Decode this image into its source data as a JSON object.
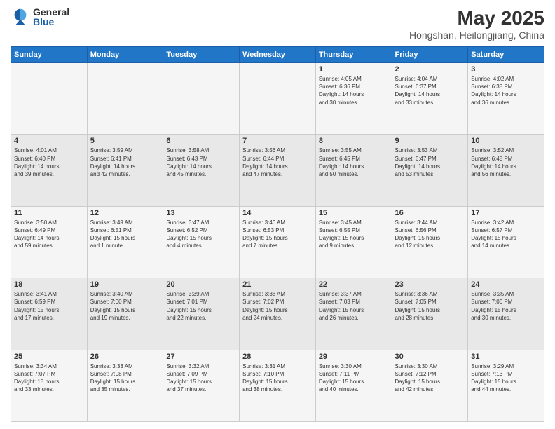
{
  "logo": {
    "general": "General",
    "blue": "Blue"
  },
  "header": {
    "title": "May 2025",
    "subtitle": "Hongshan, Heilongjiang, China"
  },
  "weekdays": [
    "Sunday",
    "Monday",
    "Tuesday",
    "Wednesday",
    "Thursday",
    "Friday",
    "Saturday"
  ],
  "weeks": [
    [
      {
        "day": "",
        "info": ""
      },
      {
        "day": "",
        "info": ""
      },
      {
        "day": "",
        "info": ""
      },
      {
        "day": "",
        "info": ""
      },
      {
        "day": "1",
        "info": "Sunrise: 4:05 AM\nSunset: 6:36 PM\nDaylight: 14 hours\nand 30 minutes."
      },
      {
        "day": "2",
        "info": "Sunrise: 4:04 AM\nSunset: 6:37 PM\nDaylight: 14 hours\nand 33 minutes."
      },
      {
        "day": "3",
        "info": "Sunrise: 4:02 AM\nSunset: 6:38 PM\nDaylight: 14 hours\nand 36 minutes."
      }
    ],
    [
      {
        "day": "4",
        "info": "Sunrise: 4:01 AM\nSunset: 6:40 PM\nDaylight: 14 hours\nand 39 minutes."
      },
      {
        "day": "5",
        "info": "Sunrise: 3:59 AM\nSunset: 6:41 PM\nDaylight: 14 hours\nand 42 minutes."
      },
      {
        "day": "6",
        "info": "Sunrise: 3:58 AM\nSunset: 6:43 PM\nDaylight: 14 hours\nand 45 minutes."
      },
      {
        "day": "7",
        "info": "Sunrise: 3:56 AM\nSunset: 6:44 PM\nDaylight: 14 hours\nand 47 minutes."
      },
      {
        "day": "8",
        "info": "Sunrise: 3:55 AM\nSunset: 6:45 PM\nDaylight: 14 hours\nand 50 minutes."
      },
      {
        "day": "9",
        "info": "Sunrise: 3:53 AM\nSunset: 6:47 PM\nDaylight: 14 hours\nand 53 minutes."
      },
      {
        "day": "10",
        "info": "Sunrise: 3:52 AM\nSunset: 6:48 PM\nDaylight: 14 hours\nand 56 minutes."
      }
    ],
    [
      {
        "day": "11",
        "info": "Sunrise: 3:50 AM\nSunset: 6:49 PM\nDaylight: 14 hours\nand 59 minutes."
      },
      {
        "day": "12",
        "info": "Sunrise: 3:49 AM\nSunset: 6:51 PM\nDaylight: 15 hours\nand 1 minute."
      },
      {
        "day": "13",
        "info": "Sunrise: 3:47 AM\nSunset: 6:52 PM\nDaylight: 15 hours\nand 4 minutes."
      },
      {
        "day": "14",
        "info": "Sunrise: 3:46 AM\nSunset: 6:53 PM\nDaylight: 15 hours\nand 7 minutes."
      },
      {
        "day": "15",
        "info": "Sunrise: 3:45 AM\nSunset: 6:55 PM\nDaylight: 15 hours\nand 9 minutes."
      },
      {
        "day": "16",
        "info": "Sunrise: 3:44 AM\nSunset: 6:56 PM\nDaylight: 15 hours\nand 12 minutes."
      },
      {
        "day": "17",
        "info": "Sunrise: 3:42 AM\nSunset: 6:57 PM\nDaylight: 15 hours\nand 14 minutes."
      }
    ],
    [
      {
        "day": "18",
        "info": "Sunrise: 3:41 AM\nSunset: 6:59 PM\nDaylight: 15 hours\nand 17 minutes."
      },
      {
        "day": "19",
        "info": "Sunrise: 3:40 AM\nSunset: 7:00 PM\nDaylight: 15 hours\nand 19 minutes."
      },
      {
        "day": "20",
        "info": "Sunrise: 3:39 AM\nSunset: 7:01 PM\nDaylight: 15 hours\nand 22 minutes."
      },
      {
        "day": "21",
        "info": "Sunrise: 3:38 AM\nSunset: 7:02 PM\nDaylight: 15 hours\nand 24 minutes."
      },
      {
        "day": "22",
        "info": "Sunrise: 3:37 AM\nSunset: 7:03 PM\nDaylight: 15 hours\nand 26 minutes."
      },
      {
        "day": "23",
        "info": "Sunrise: 3:36 AM\nSunset: 7:05 PM\nDaylight: 15 hours\nand 28 minutes."
      },
      {
        "day": "24",
        "info": "Sunrise: 3:35 AM\nSunset: 7:06 PM\nDaylight: 15 hours\nand 30 minutes."
      }
    ],
    [
      {
        "day": "25",
        "info": "Sunrise: 3:34 AM\nSunset: 7:07 PM\nDaylight: 15 hours\nand 33 minutes."
      },
      {
        "day": "26",
        "info": "Sunrise: 3:33 AM\nSunset: 7:08 PM\nDaylight: 15 hours\nand 35 minutes."
      },
      {
        "day": "27",
        "info": "Sunrise: 3:32 AM\nSunset: 7:09 PM\nDaylight: 15 hours\nand 37 minutes."
      },
      {
        "day": "28",
        "info": "Sunrise: 3:31 AM\nSunset: 7:10 PM\nDaylight: 15 hours\nand 38 minutes."
      },
      {
        "day": "29",
        "info": "Sunrise: 3:30 AM\nSunset: 7:11 PM\nDaylight: 15 hours\nand 40 minutes."
      },
      {
        "day": "30",
        "info": "Sunrise: 3:30 AM\nSunset: 7:12 PM\nDaylight: 15 hours\nand 42 minutes."
      },
      {
        "day": "31",
        "info": "Sunrise: 3:29 AM\nSunset: 7:13 PM\nDaylight: 15 hours\nand 44 minutes."
      }
    ]
  ]
}
